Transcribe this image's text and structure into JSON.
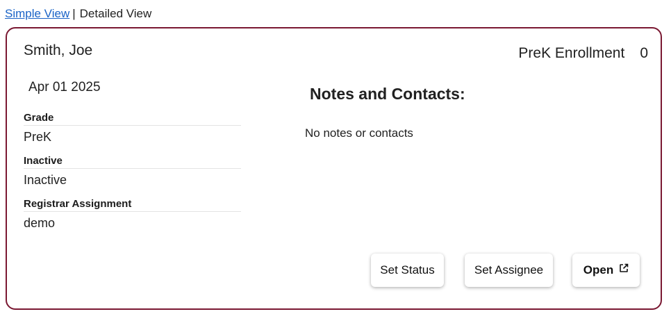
{
  "view_switch": {
    "simple_label": "Simple View",
    "separator": "|",
    "detailed_label": "Detailed View"
  },
  "card": {
    "student_name": "Smith, Joe",
    "date": "Apr 01 2025",
    "fields": [
      {
        "label": "Grade",
        "value": "PreK"
      },
      {
        "label": "Inactive",
        "value": "Inactive"
      },
      {
        "label": "Registrar Assignment",
        "value": "demo"
      }
    ],
    "enrollment": {
      "label": "PreK Enrollment",
      "count": "0"
    },
    "notes": {
      "title": "Notes and Contacts:",
      "empty_text": "No notes or contacts"
    },
    "buttons": {
      "set_status": "Set Status",
      "set_assignee": "Set Assignee",
      "open": "Open",
      "open_icon": "external-link-icon"
    }
  },
  "colors": {
    "card_border": "#7a1832",
    "link": "#1a63c7"
  }
}
